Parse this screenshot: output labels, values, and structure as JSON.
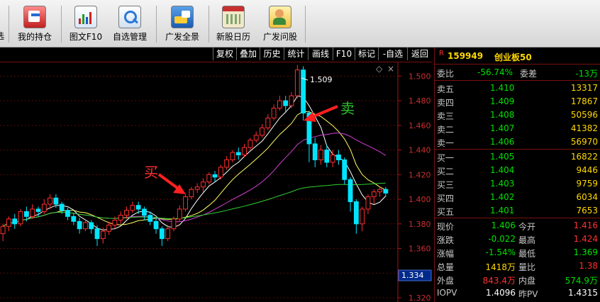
{
  "toolbar": {
    "items": [
      {
        "label": "我的持仓",
        "icon": "portfolio-icon"
      },
      {
        "label": "图文F10",
        "icon": "chart-doc-icon"
      },
      {
        "label": "自选管理",
        "icon": "watchlist-manage-icon"
      },
      {
        "label": "广发全景",
        "icon": "panorama-icon"
      },
      {
        "label": "新股日历",
        "icon": "calendar-icon"
      },
      {
        "label": "广发问股",
        "icon": "ask-stock-icon"
      }
    ],
    "left_fragment": "选"
  },
  "chart_nav": [
    "复权",
    "叠加",
    "历史",
    "统计",
    "画线",
    "F10",
    "标记",
    "-自选",
    "返回"
  ],
  "chart": {
    "diamond_marker": "◇",
    "close_marker": "×",
    "high_label": "1.509",
    "buy_label": "买",
    "sell_label": "卖",
    "current_price_tag": "1.334",
    "y_ticks": [
      "1.500",
      "1.480",
      "1.460",
      "1.440",
      "1.420",
      "1.400",
      "1.380",
      "1.360",
      "1.340",
      "1.320"
    ],
    "colors": {
      "up": "#ff3030",
      "down": "#00e5ff",
      "ma5": "#ffffff",
      "ma10": "#ffff66",
      "ma20": "#d040d0",
      "ma60": "#30d030",
      "buy_text": "#ff3030",
      "sell_text": "#30c030"
    }
  },
  "chart_data": {
    "type": "candlestick",
    "y_axis_ticks": [
      1.5,
      1.48,
      1.46,
      1.44,
      1.42,
      1.4,
      1.38,
      1.36,
      1.34,
      1.32
    ],
    "ylim": [
      1.32,
      1.51
    ],
    "candles": [
      [
        1.372,
        1.378,
        1.366,
        1.38
      ],
      [
        1.378,
        1.384,
        1.374,
        1.386
      ],
      [
        1.384,
        1.38,
        1.376,
        1.388
      ],
      [
        1.38,
        1.39,
        1.378,
        1.392
      ],
      [
        1.39,
        1.386,
        1.382,
        1.394
      ],
      [
        1.386,
        1.392,
        1.384,
        1.396
      ],
      [
        1.392,
        1.39,
        1.386,
        1.394
      ],
      [
        1.39,
        1.396,
        1.388,
        1.4
      ],
      [
        1.396,
        1.401,
        1.392,
        1.404
      ],
      [
        1.401,
        1.396,
        1.393,
        1.404
      ],
      [
        1.396,
        1.391,
        1.388,
        1.398
      ],
      [
        1.391,
        1.386,
        1.383,
        1.393
      ],
      [
        1.386,
        1.382,
        1.379,
        1.389
      ],
      [
        1.382,
        1.376,
        1.372,
        1.385
      ],
      [
        1.376,
        1.381,
        1.374,
        1.384
      ],
      [
        1.381,
        1.376,
        1.372,
        1.383
      ],
      [
        1.376,
        1.368,
        1.362,
        1.379
      ],
      [
        1.368,
        1.374,
        1.364,
        1.377
      ],
      [
        1.374,
        1.379,
        1.371,
        1.382
      ],
      [
        1.379,
        1.383,
        1.376,
        1.386
      ],
      [
        1.383,
        1.387,
        1.38,
        1.39
      ],
      [
        1.387,
        1.391,
        1.384,
        1.394
      ],
      [
        1.391,
        1.395,
        1.389,
        1.398
      ],
      [
        1.395,
        1.392,
        1.388,
        1.398
      ],
      [
        1.392,
        1.387,
        1.383,
        1.394
      ],
      [
        1.387,
        1.382,
        1.379,
        1.39
      ],
      [
        1.382,
        1.376,
        1.372,
        1.385
      ],
      [
        1.376,
        1.368,
        1.362,
        1.378
      ],
      [
        1.368,
        1.376,
        1.366,
        1.379
      ],
      [
        1.376,
        1.384,
        1.374,
        1.386
      ],
      [
        1.384,
        1.392,
        1.382,
        1.395
      ],
      [
        1.392,
        1.402,
        1.39,
        1.404
      ],
      [
        1.402,
        1.408,
        1.4,
        1.41
      ],
      [
        1.408,
        1.41,
        1.405,
        1.413
      ],
      [
        1.41,
        1.414,
        1.406,
        1.417
      ],
      [
        1.414,
        1.42,
        1.412,
        1.422
      ],
      [
        1.42,
        1.418,
        1.414,
        1.423
      ],
      [
        1.418,
        1.426,
        1.416,
        1.428
      ],
      [
        1.426,
        1.432,
        1.424,
        1.435
      ],
      [
        1.432,
        1.438,
        1.43,
        1.44
      ],
      [
        1.438,
        1.436,
        1.432,
        1.442
      ],
      [
        1.436,
        1.442,
        1.434,
        1.445
      ],
      [
        1.442,
        1.448,
        1.44,
        1.45
      ],
      [
        1.448,
        1.452,
        1.446,
        1.455
      ],
      [
        1.452,
        1.458,
        1.45,
        1.461
      ],
      [
        1.458,
        1.466,
        1.456,
        1.469
      ],
      [
        1.466,
        1.474,
        1.464,
        1.477
      ],
      [
        1.474,
        1.48,
        1.472,
        1.484
      ],
      [
        1.48,
        1.476,
        1.47,
        1.484
      ],
      [
        1.476,
        1.484,
        1.474,
        1.487
      ],
      [
        1.484,
        1.505,
        1.482,
        1.509
      ],
      [
        1.505,
        1.47,
        1.464,
        1.508
      ],
      [
        1.47,
        1.445,
        1.43,
        1.472
      ],
      [
        1.445,
        1.432,
        1.426,
        1.45
      ],
      [
        1.432,
        1.44,
        1.428,
        1.444
      ],
      [
        1.44,
        1.43,
        1.426,
        1.444
      ],
      [
        1.43,
        1.436,
        1.426,
        1.44
      ],
      [
        1.436,
        1.432,
        1.428,
        1.44
      ],
      [
        1.432,
        1.416,
        1.412,
        1.434
      ],
      [
        1.416,
        1.398,
        1.39,
        1.418
      ],
      [
        1.398,
        1.38,
        1.372,
        1.4
      ],
      [
        1.38,
        1.392,
        1.374,
        1.394
      ],
      [
        1.392,
        1.402,
        1.388,
        1.404
      ],
      [
        1.402,
        1.406,
        1.396,
        1.408
      ],
      [
        1.406,
        1.408,
        1.402,
        1.41
      ],
      [
        1.408,
        1.405,
        1.402,
        1.41
      ]
    ],
    "series": [
      {
        "name": "MA5"
      },
      {
        "name": "MA10"
      },
      {
        "name": "MA20"
      },
      {
        "name": "MA60"
      }
    ]
  },
  "quote": {
    "code_prefix": "R",
    "code": "159949",
    "name": "创业板50",
    "weibi_label": "委比",
    "weibi": "-56.74%",
    "weicha_label": "委差",
    "weicha": "-13万",
    "asks": [
      {
        "label": "卖五",
        "price": "1.410",
        "vol": "13317"
      },
      {
        "label": "卖四",
        "price": "1.409",
        "vol": "17867"
      },
      {
        "label": "卖三",
        "price": "1.408",
        "vol": "50596"
      },
      {
        "label": "卖二",
        "price": "1.407",
        "vol": "41382"
      },
      {
        "label": "卖一",
        "price": "1.406",
        "vol": "56970"
      }
    ],
    "bids": [
      {
        "label": "买一",
        "price": "1.405",
        "vol": "16822"
      },
      {
        "label": "买二",
        "price": "1.404",
        "vol": "9446"
      },
      {
        "label": "买三",
        "price": "1.403",
        "vol": "9759"
      },
      {
        "label": "买四",
        "price": "1.402",
        "vol": "6034"
      },
      {
        "label": "买五",
        "price": "1.401",
        "vol": "7653"
      }
    ],
    "stats": [
      {
        "l1": "现价",
        "v1": "1.406",
        "l2": "今开",
        "v2": "1.416"
      },
      {
        "l1": "涨跌",
        "v1": "-0.022",
        "l2": "最高",
        "v2": "1.424"
      },
      {
        "l1": "涨幅",
        "v1": "-1.54%",
        "l2": "最低",
        "v2": "1.369"
      },
      {
        "l1": "总量",
        "v1": "1418万",
        "l2": "量比",
        "v2": "1.38"
      },
      {
        "l1": "外盘",
        "v1": "843.4万",
        "l2": "内盘",
        "v2": "574.9万"
      },
      {
        "l1": "IOPV",
        "v1": "1.4096",
        "l2": "昨PV",
        "v2": "1.4315"
      }
    ]
  }
}
